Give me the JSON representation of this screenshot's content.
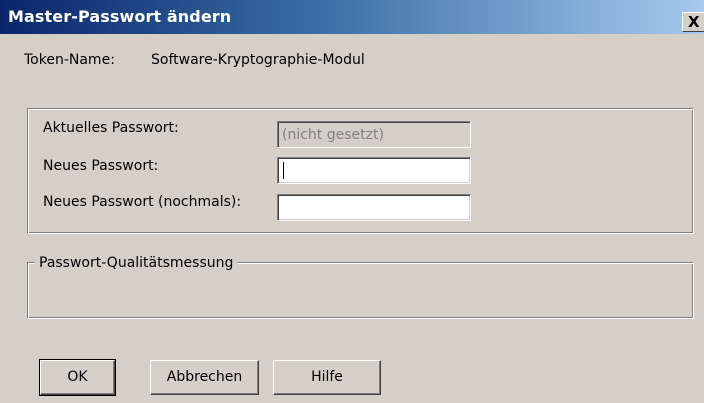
{
  "window": {
    "title": "Master-Passwort ändern",
    "close_glyph": "X"
  },
  "token": {
    "label": "Token-Name:",
    "value": "Software-Kryptographie-Modul"
  },
  "password_group": {
    "current_label": "Aktuelles Passwort:",
    "current_placeholder": "(nicht gesetzt)",
    "current_value": "",
    "new_label": "Neues Passwort:",
    "new_value": "",
    "confirm_label": "Neues Passwort (nochmals):",
    "confirm_value": ""
  },
  "quality_group": {
    "legend": "Passwort-Qualitätsmessung"
  },
  "buttons": {
    "ok": "OK",
    "cancel": "Abbrechen",
    "help": "Hilfe"
  },
  "colors": {
    "title_gradient_start": "#0a246a",
    "title_gradient_end": "#a6caf0",
    "dialog_face": "#d4d0c8"
  },
  "icons": {
    "close": "close-icon"
  }
}
